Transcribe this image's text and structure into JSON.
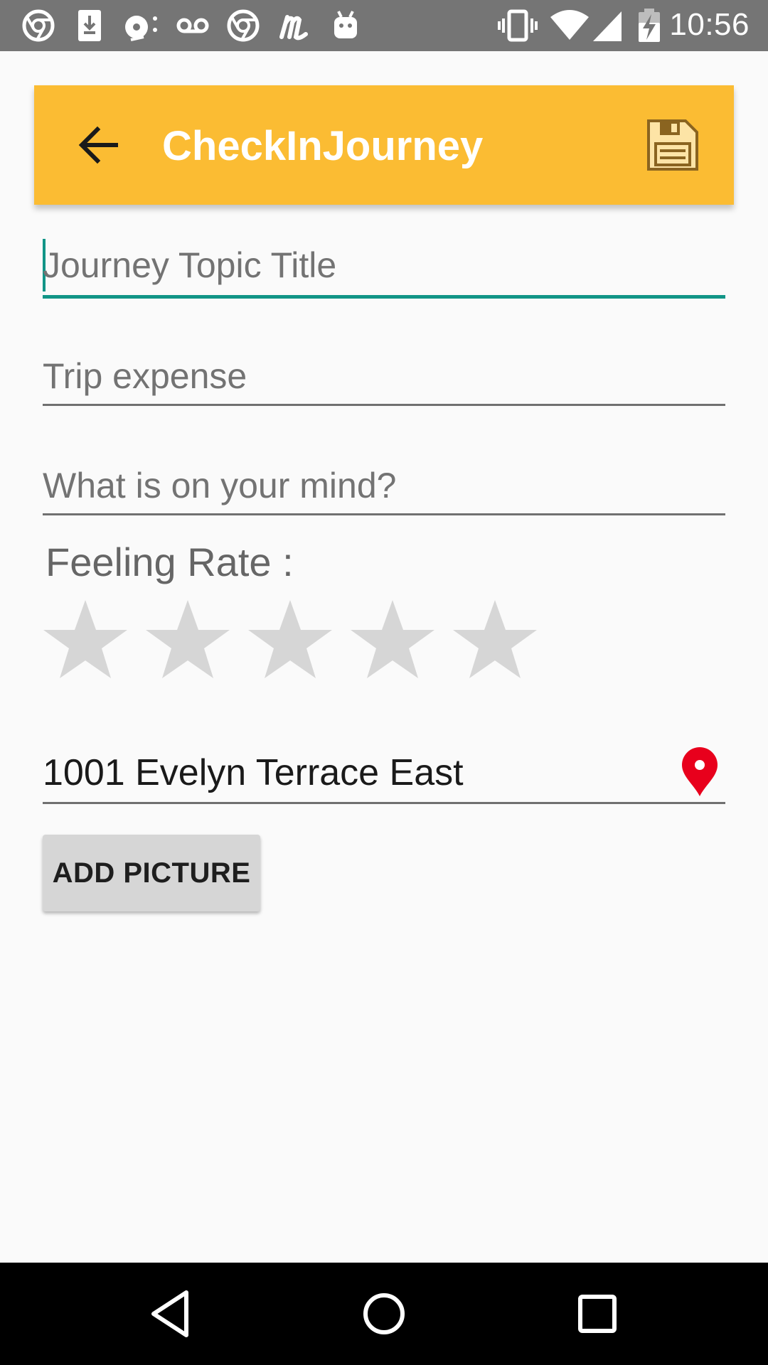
{
  "status_bar": {
    "time": "10:56",
    "left_icons": [
      "chrome-icon",
      "download-icon",
      "media-icon",
      "voicemail-icon",
      "chrome-icon",
      "m-app-icon",
      "android-icon"
    ],
    "right_icons": [
      "vibrate-icon",
      "wifi-icon",
      "cell-signal-icon",
      "battery-charging-icon"
    ]
  },
  "app_bar": {
    "title": "CheckInJourney",
    "color": "#fbbc33",
    "back_icon": "arrow-back-icon",
    "save_icon": "floppy-disk-icon"
  },
  "form": {
    "journey_title": {
      "placeholder": "Journey Topic Title",
      "value": ""
    },
    "trip_expense": {
      "placeholder": "Trip expense",
      "value": ""
    },
    "mind": {
      "placeholder": "What is on your mind?",
      "value": ""
    },
    "feeling_label": "Feeling Rate :",
    "rating": {
      "value": 0,
      "max": 5
    },
    "location": {
      "value": "1001 Evelyn Terrace East",
      "icon": "map-pin-icon",
      "icon_color": "#e8001c"
    },
    "add_picture_label": "ADD PICTURE"
  },
  "accent_color": "#119587",
  "nav_bar": {
    "back": "triangle-back-icon",
    "home": "circle-home-icon",
    "recents": "square-recents-icon"
  }
}
